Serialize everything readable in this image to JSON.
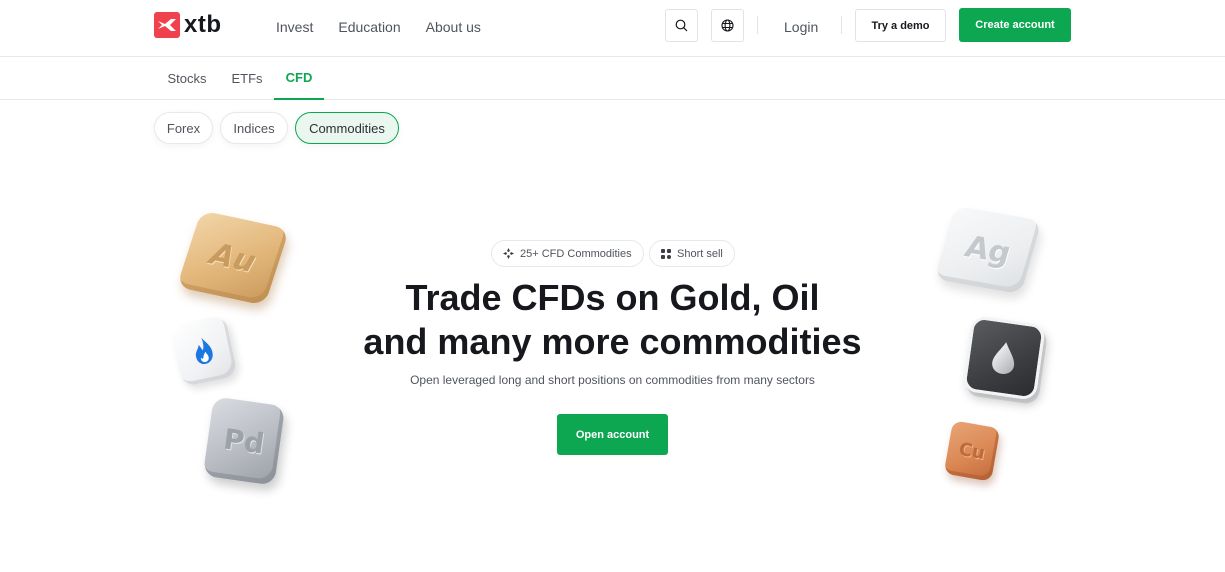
{
  "header": {
    "logo_text": "xtb",
    "nav": [
      "Invest",
      "Education",
      "About us"
    ],
    "search_icon": "search-icon",
    "language_icon": "globe-icon",
    "login": "Login",
    "try_demo": "Try a demo",
    "create_account": "Create account"
  },
  "subnav": {
    "tabs": [
      {
        "label": "Stocks",
        "active": false
      },
      {
        "label": "ETFs",
        "active": false
      },
      {
        "label": "CFD",
        "active": true
      }
    ]
  },
  "pills": [
    {
      "label": "Forex",
      "active": false
    },
    {
      "label": "Indices",
      "active": false
    },
    {
      "label": "Commodities",
      "active": true
    }
  ],
  "hero": {
    "badges": [
      {
        "icon": "commodities-icon",
        "label": "25+ CFD Commodities"
      },
      {
        "icon": "short-sell-icon",
        "label": "Short sell"
      }
    ],
    "title_line1": "Trade CFDs on Gold, Oil",
    "title_line2": "and many more commodities",
    "subtitle": "Open leveraged long and short positions on commodities from many sectors",
    "cta": "Open account"
  },
  "tiles": {
    "gold": "Au",
    "silver": "Ag",
    "palladium": "Pd",
    "copper": "Cu",
    "gas": "flame-icon",
    "oil": "oil-drop-icon"
  },
  "colors": {
    "brand_red": "#f0424d",
    "accent_green": "#0ca750"
  }
}
